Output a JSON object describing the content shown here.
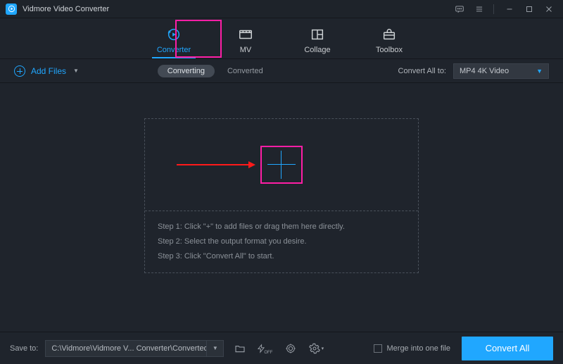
{
  "app": {
    "title": "Vidmore Video Converter"
  },
  "tabs": [
    {
      "label": "Converter",
      "active": true
    },
    {
      "label": "MV"
    },
    {
      "label": "Collage"
    },
    {
      "label": "Toolbox"
    }
  ],
  "toolbar": {
    "add_files": "Add Files",
    "converting": "Converting",
    "converted": "Converted",
    "convert_all_to": "Convert All to:",
    "format": "MP4 4K Video"
  },
  "steps": {
    "s1": "Step 1: Click \"+\" to add files or drag them here directly.",
    "s2": "Step 2: Select the output format you desire.",
    "s3": "Step 3: Click \"Convert All\" to start."
  },
  "footer": {
    "save_to": "Save to:",
    "path": "C:\\Vidmore\\Vidmore V... Converter\\Converted",
    "merge": "Merge into one file",
    "convert_all": "Convert All"
  }
}
